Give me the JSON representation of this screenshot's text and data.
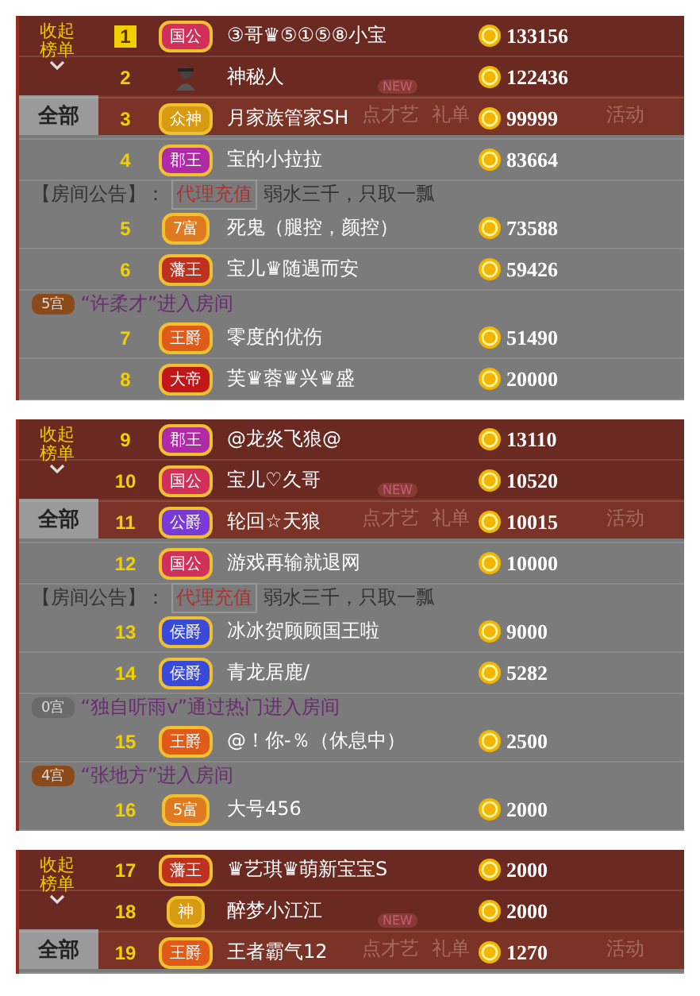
{
  "panels": [
    {
      "collapse_label": "收起榜单",
      "tabs": [
        {
          "label": "全部",
          "selected": true
        },
        {
          "label": "点才艺",
          "selected": false,
          "badge": "NEW"
        },
        {
          "label": "礼单",
          "selected": false
        },
        {
          "label": "活动",
          "selected": false
        }
      ],
      "items": [
        {
          "kind": "rank",
          "rank": "1",
          "top": true,
          "badge": {
            "kind": "title",
            "text": "国公",
            "color": "#d0305a"
          },
          "name": "③哥♛⑤①⑤⑧小宝",
          "score": "133156"
        },
        {
          "kind": "rank",
          "rank": "2",
          "top": false,
          "badge": {
            "kind": "avatar"
          },
          "name": "神秘人",
          "score": "122436"
        },
        {
          "kind": "rank",
          "rank": "3",
          "top": false,
          "badge": {
            "kind": "title",
            "text": "众神",
            "color": "#d89a10"
          },
          "name": "月家族管家SH",
          "score": "99999"
        },
        {
          "kind": "rank",
          "rank": "4",
          "top": false,
          "badge": {
            "kind": "title",
            "text": "郡王",
            "color": "#b02aa8"
          },
          "name": "宝的小拉拉",
          "score": "83664"
        },
        {
          "kind": "notice",
          "label": "【房间公告】：",
          "tag": "代理充值",
          "text": "弱水三千，只取一瓢"
        },
        {
          "kind": "rank",
          "rank": "5",
          "top": false,
          "badge": {
            "kind": "title",
            "text": "7富",
            "color": "#e07a20"
          },
          "name": "死鬼（腿控，颜控）",
          "score": "73588"
        },
        {
          "kind": "rank",
          "rank": "6",
          "top": false,
          "badge": {
            "kind": "title",
            "text": "藩王",
            "color": "#c0301e"
          },
          "name": "宝儿♛随遇而安",
          "score": "59426"
        },
        {
          "kind": "chat",
          "tag": "5宫",
          "color": "#8a4a1a",
          "text": "“许柔才”进入房间"
        },
        {
          "kind": "rank",
          "rank": "7",
          "top": false,
          "badge": {
            "kind": "title",
            "text": "王爵",
            "color": "#e05a18"
          },
          "name": "零度的优伤",
          "score": "51490"
        },
        {
          "kind": "rank",
          "rank": "8",
          "top": false,
          "badge": {
            "kind": "title",
            "text": "大帝",
            "color": "#c01818"
          },
          "name": "芙♛蓉♛兴♛盛",
          "score": "20000"
        }
      ]
    },
    {
      "collapse_label": "收起榜单",
      "tabs": [
        {
          "label": "全部",
          "selected": true
        },
        {
          "label": "点才艺",
          "selected": false,
          "badge": "NEW"
        },
        {
          "label": "礼单",
          "selected": false
        },
        {
          "label": "活动",
          "selected": false
        }
      ],
      "items": [
        {
          "kind": "rank",
          "rank": "9",
          "top": false,
          "badge": {
            "kind": "title",
            "text": "郡王",
            "color": "#b02aa8"
          },
          "name": "@龙炎飞狼@",
          "score": "13110"
        },
        {
          "kind": "rank",
          "rank": "10",
          "top": false,
          "badge": {
            "kind": "title",
            "text": "国公",
            "color": "#d0305a"
          },
          "name": "宝儿♡久哥",
          "score": "10520"
        },
        {
          "kind": "rank",
          "rank": "11",
          "top": false,
          "badge": {
            "kind": "title",
            "text": "公爵",
            "color": "#7a3ad8"
          },
          "name": "轮回☆天狼",
          "score": "10015"
        },
        {
          "kind": "rank",
          "rank": "12",
          "top": false,
          "badge": {
            "kind": "title",
            "text": "国公",
            "color": "#d0305a"
          },
          "name": "游戏再输就退网",
          "score": "10000"
        },
        {
          "kind": "notice",
          "label": "【房间公告】：",
          "tag": "代理充值",
          "text": "弱水三千，只取一瓢"
        },
        {
          "kind": "rank",
          "rank": "13",
          "top": false,
          "badge": {
            "kind": "title",
            "text": "侯爵",
            "color": "#3a4ad8"
          },
          "name": "冰冰贺顾顾国王啦",
          "score": "9000"
        },
        {
          "kind": "rank",
          "rank": "14",
          "top": false,
          "badge": {
            "kind": "title",
            "text": "侯爵",
            "color": "#3a4ad8"
          },
          "name": "青龙居鹿/",
          "score": "5282"
        },
        {
          "kind": "chat",
          "tag": "0宫",
          "color": "#6a6a6a",
          "text": "“独自听雨v”通过热门进入房间"
        },
        {
          "kind": "rank",
          "rank": "15",
          "top": false,
          "badge": {
            "kind": "title",
            "text": "王爵",
            "color": "#e05a18"
          },
          "name": "@！你-％（休息中）",
          "score": "2500"
        },
        {
          "kind": "chat",
          "tag": "4宫",
          "color": "#8a4a1a",
          "text": "“张地方”进入房间"
        },
        {
          "kind": "rank",
          "rank": "16",
          "top": false,
          "badge": {
            "kind": "title",
            "text": "5富",
            "color": "#e07a20"
          },
          "name": "大号456",
          "score": "2000"
        }
      ]
    },
    {
      "collapse_label": "收起榜单",
      "tabs": [
        {
          "label": "全部",
          "selected": true
        },
        {
          "label": "点才艺",
          "selected": false,
          "badge": "NEW"
        },
        {
          "label": "礼单",
          "selected": false
        },
        {
          "label": "活动",
          "selected": false
        }
      ],
      "items": [
        {
          "kind": "rank",
          "rank": "17",
          "top": false,
          "badge": {
            "kind": "title",
            "text": "藩王",
            "color": "#c0301e"
          },
          "name": "♛艺琪♛萌新宝宝S",
          "score": "2000"
        },
        {
          "kind": "rank",
          "rank": "18",
          "top": false,
          "badge": {
            "kind": "title",
            "text": "神",
            "color": "#d89a10"
          },
          "name": "醉梦小江江",
          "score": "2000"
        },
        {
          "kind": "rank",
          "rank": "19",
          "top": false,
          "badge": {
            "kind": "title",
            "text": "王爵",
            "color": "#e05a18"
          },
          "name": "王者霸气12",
          "score": "1270"
        }
      ]
    }
  ]
}
